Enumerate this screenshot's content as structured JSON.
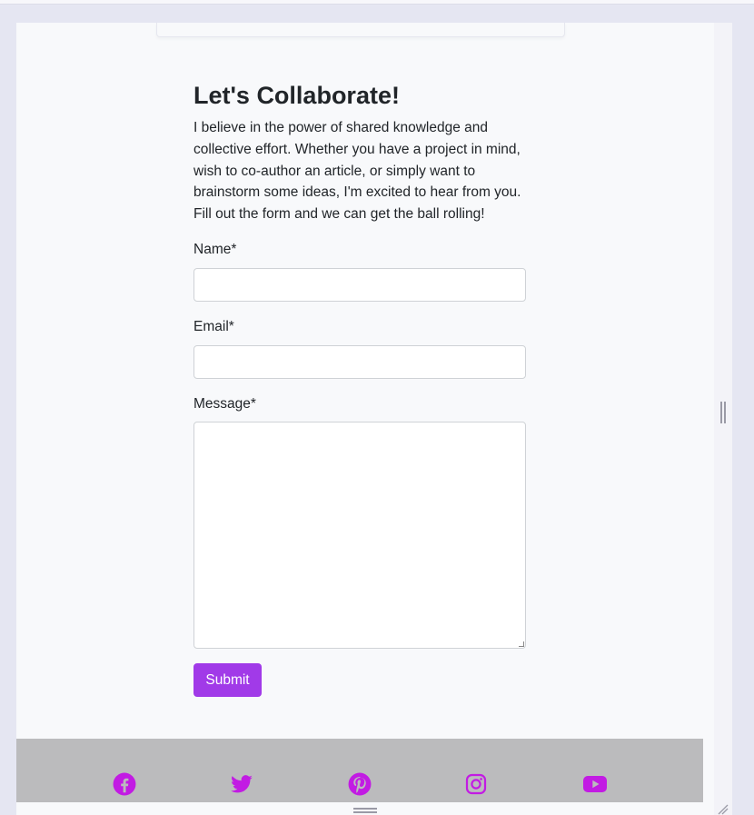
{
  "heading": "Let's Collaborate!",
  "intro": "I believe in the power of shared knowledge and collective effort. Whether you have a project in mind, wish to co-author an article, or simply want to brainstorm some ideas, I'm excited to hear from you. Fill out the form and we can get the ball rolling!",
  "form": {
    "name_label": "Name*",
    "name_value": "",
    "email_label": "Email*",
    "email_value": "",
    "message_label": "Message*",
    "message_value": "",
    "submit_label": "Submit"
  },
  "footer": {
    "icons": [
      "facebook-icon",
      "twitter-icon",
      "pinterest-icon",
      "instagram-icon",
      "youtube-icon"
    ],
    "icon_color": "#c21be3"
  },
  "colors": {
    "accent": "#a13ae8",
    "footer_bg": "#bbbbbd",
    "page_bg": "#f8f9fb"
  }
}
